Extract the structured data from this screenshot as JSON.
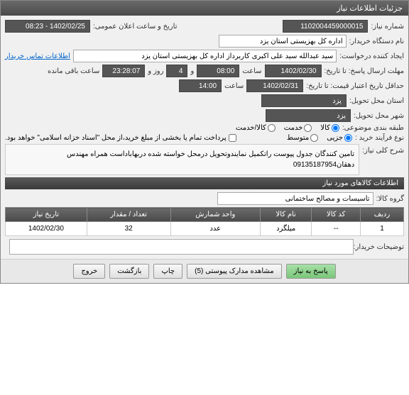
{
  "titlebar": "جزئیات اطلاعات نیاز",
  "rows": {
    "need_no_label": "شماره نیاز:",
    "need_no": "1102004459000015",
    "announce_label": "تاریخ و ساعت اعلان عمومی:",
    "announce_value": "1402/02/25 - 08:23",
    "buyer_label": "نام دستگاه خریدار:",
    "buyer_value": "اداره کل بهزیستی استان یزد",
    "creator_label": "ایجاد کننده درخواست:",
    "creator_value": "سید عبدالله سید علی اکبری کاربرداز اداره کل بهزیستی استان یزد",
    "contact_link": "اطلاعات تماس خریدار",
    "deadline_label": "مهلت ارسال پاسخ: تا تاریخ:",
    "deadline_date": "1402/02/30",
    "time_label": "ساعت",
    "deadline_time": "08:00",
    "and_label": "و",
    "days": "4",
    "days_label": "روز و",
    "remain_time": "23:28:07",
    "remain_label": "ساعت باقی مانده",
    "validity_label": "حداقل تاریخ اعتبار قیمت: تا تاریخ:",
    "validity_date": "1402/02/31",
    "validity_time": "14:00",
    "province_label": "استان محل تحویل:",
    "province": "یزد",
    "city_label": "شهر محل تحویل:",
    "city": "یزد",
    "category_label": "طبقه بندی موضوعی:",
    "cat_goods": "کالا",
    "cat_service": "خدمت",
    "cat_both": "کالا/خدمت",
    "process_label": "نوع فرآیند خرید :",
    "proc_partial": "جزیی",
    "proc_medium": "متوسط",
    "pay_note": "پرداخت تمام یا بخشی از مبلغ خرید،از محل \"اسناد خزانه اسلامی\" خواهد بود.",
    "desc_label": "شرح کلی نیاز:",
    "desc_text": "تامین کنندگان جدول پیوست راتکمیل نمایندوتحویل درمحل خواسته شده دربهاباداست همراه مهندس دهقان09135187954",
    "items_header": "اطلاعات کالاهای مورد نیاز",
    "group_label": "گروه کالا:",
    "group_value": "تاسیسات و مصالح ساختمانی",
    "notes_label": "توضیحات خریدار:"
  },
  "table": {
    "headers": [
      "ردیف",
      "کد کالا",
      "نام کالا",
      "واحد شمارش",
      "تعداد / مقدار",
      "تاریخ نیاز"
    ],
    "row": [
      "1",
      "--",
      "میلگرد",
      "عدد",
      "32",
      "1402/02/30"
    ]
  },
  "buttons": {
    "reply": "پاسخ به نیاز",
    "attachments": "مشاهده مدارک پیوستی (5)",
    "print": "چاپ",
    "back": "بازگشت",
    "exit": "خروج"
  }
}
